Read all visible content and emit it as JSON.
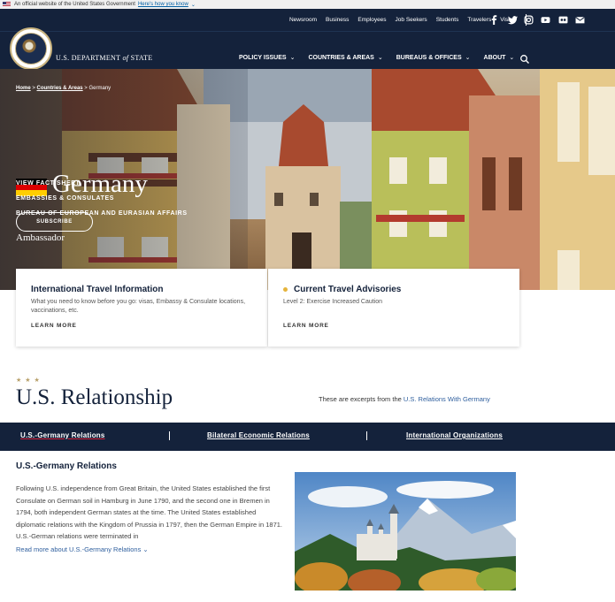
{
  "official_banner": {
    "text": "An official website of the United States Government",
    "link": "Here's how you know",
    "chevron": "chevron-down-icon"
  },
  "utility_nav": [
    "Newsroom",
    "Business",
    "Employees",
    "Job Seekers",
    "Students",
    "Travelers",
    "Visas"
  ],
  "social_icons": [
    "facebook-icon",
    "twitter-icon",
    "instagram-icon",
    "youtube-icon",
    "flickr-icon",
    "email-icon"
  ],
  "header": {
    "dept_name_pre": "U.S. DEPARTMENT ",
    "dept_name_of": "of",
    "dept_name_post": " STATE"
  },
  "main_nav": [
    {
      "label": "POLICY ISSUES"
    },
    {
      "label": "COUNTRIES & AREAS"
    },
    {
      "label": "BUREAUS & OFFICES"
    },
    {
      "label": "ABOUT"
    }
  ],
  "hero": {
    "breadcrumb": {
      "home": "Home",
      "sep1": " > ",
      "countries": "Countries & Areas",
      "sep2": " > ",
      "current": "Germany"
    },
    "title": "Germany",
    "flag_colors": [
      "#000000",
      "#dd0000",
      "#ffce00"
    ],
    "subscribe": "SUBSCRIBE",
    "links": [
      "VIEW FACT SHEET",
      "EMBASSIES & CONSULATES",
      "BUREAU OF EUROPEAN AND EURASIAN AFFAIRS"
    ],
    "ambassador": "Ambassador"
  },
  "cards": [
    {
      "title": "International Travel Information",
      "desc": "What you need to know before you go: visas, Embassy & Consulate locations, vaccinations, etc.",
      "link": "LEARN MORE"
    },
    {
      "title": "Current Travel Advisories",
      "desc": "Level 2: Exercise Increased Caution",
      "link": "LEARN MORE"
    }
  ],
  "relationship": {
    "stars": "★ ★ ★",
    "title": "U.S. Relationship",
    "excerpt_pre": "These are excerpts from the ",
    "excerpt_link": "U.S. Relations With Germany",
    "tabs": [
      "U.S.-Germany Relations",
      "Bilateral Economic Relations",
      "International Organizations"
    ],
    "section_title": "U.S.-Germany Relations",
    "section_body": "Following U.S. independence from Great Britain, the United States established the first Consulate on German soil in Hamburg in June 1790, and the second one in Bremen in 1794, both independent German states at the time. The United States established diplomatic relations with the Kingdom of Prussia in 1797, then the German Empire in 1871. U.S.-German relations were terminated in",
    "read_more": "Read more about U.S.-Germany Relations"
  },
  "colors": {
    "navy": "#14223b",
    "gold": "#c9b37e",
    "accent_red": "#d9233a",
    "link_blue": "#2f5f9e",
    "advisory_yellow": "#e5b43c"
  }
}
